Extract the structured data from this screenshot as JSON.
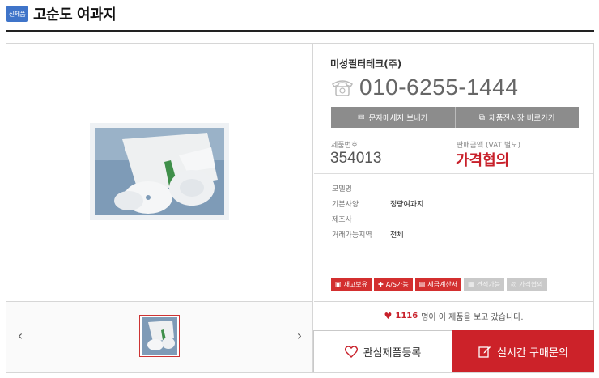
{
  "header": {
    "badge": "신제품",
    "title": "고순도 여과지"
  },
  "product": {
    "company": "미성필터테크(주)",
    "phone": "010-6255-1444",
    "buttons": {
      "sms": "문자메세지 보내기",
      "showroom": "제품전시장 바로가기"
    },
    "code_label": "제품번호",
    "code": "354013",
    "price_label": "판매금액 (VAT 별도)",
    "price": "가격협의",
    "specs": [
      {
        "label": "모델명",
        "value": ""
      },
      {
        "label": "기본사양",
        "value": "정량여과지"
      },
      {
        "label": "제조사",
        "value": ""
      },
      {
        "label": "거래가능지역",
        "value": "전체"
      }
    ],
    "tags": [
      {
        "label": "재고보유",
        "active": true,
        "icon": "box-icon"
      },
      {
        "label": "A/S가능",
        "active": true,
        "icon": "wrench-icon"
      },
      {
        "label": "세금계산서",
        "active": true,
        "icon": "receipt-icon"
      },
      {
        "label": "견적가능",
        "active": false,
        "icon": "calculator-icon"
      },
      {
        "label": "가격협의",
        "active": false,
        "icon": "handshake-icon"
      }
    ],
    "views": {
      "count": "1116",
      "suffix": "명이 이 제품을 보고 갔습니다."
    },
    "cta": {
      "favorite": "관심제품등록",
      "inquiry": "실시간 구매문의"
    }
  },
  "gallery": {
    "prev": "‹",
    "next": "›"
  },
  "colors": {
    "accent": "#cc2229",
    "badge": "#3f74c9",
    "gray_button": "#8c8c8c"
  }
}
